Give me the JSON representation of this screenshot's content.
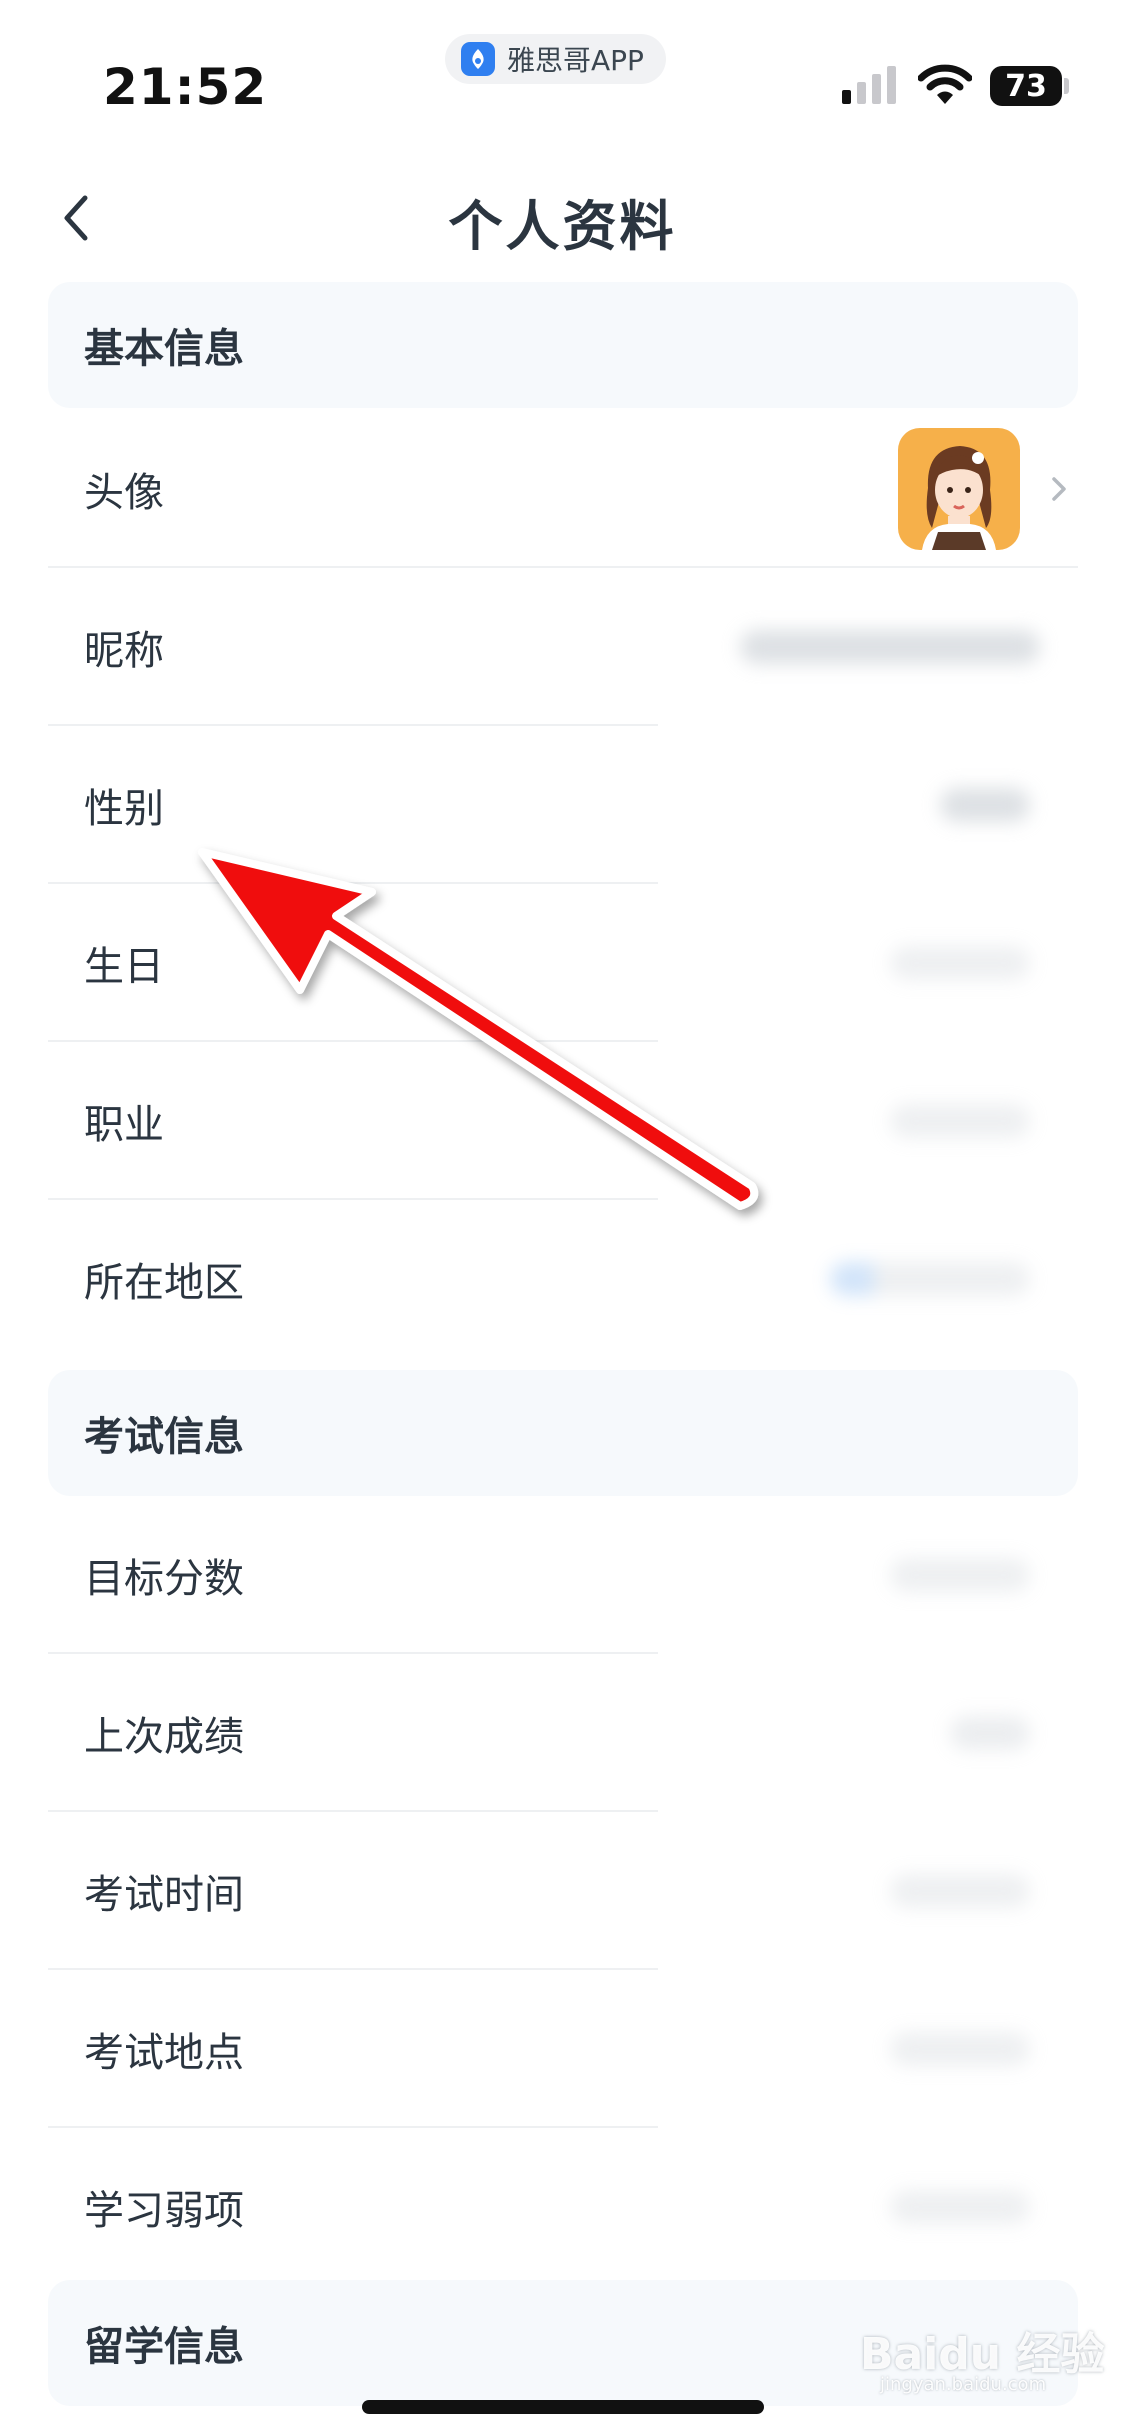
{
  "status_bar": {
    "time": "21:52",
    "app_pill": "雅思哥APP",
    "battery": "73"
  },
  "nav": {
    "title": "个人资料"
  },
  "sections": {
    "basic": {
      "title": "基本信息",
      "rows": {
        "avatar": "头像",
        "nickname": "昵称",
        "gender": "性别",
        "birthday": "生日",
        "occupation": "职业",
        "region": "所在地区"
      }
    },
    "exam": {
      "title": "考试信息",
      "rows": {
        "target_score": "目标分数",
        "last_score": "上次成绩",
        "exam_time": "考试时间",
        "exam_place": "考试地点",
        "weak_item": "学习弱项"
      }
    },
    "study_abroad": {
      "title": "留学信息"
    }
  },
  "watermark": {
    "brand": "Baidu 经验",
    "url": "jingyan.baidu.com"
  },
  "colors": {
    "accent_arrow": "#f01010",
    "section_bg": "#f6f9fc",
    "avatar_bg": "#f6b04a"
  }
}
